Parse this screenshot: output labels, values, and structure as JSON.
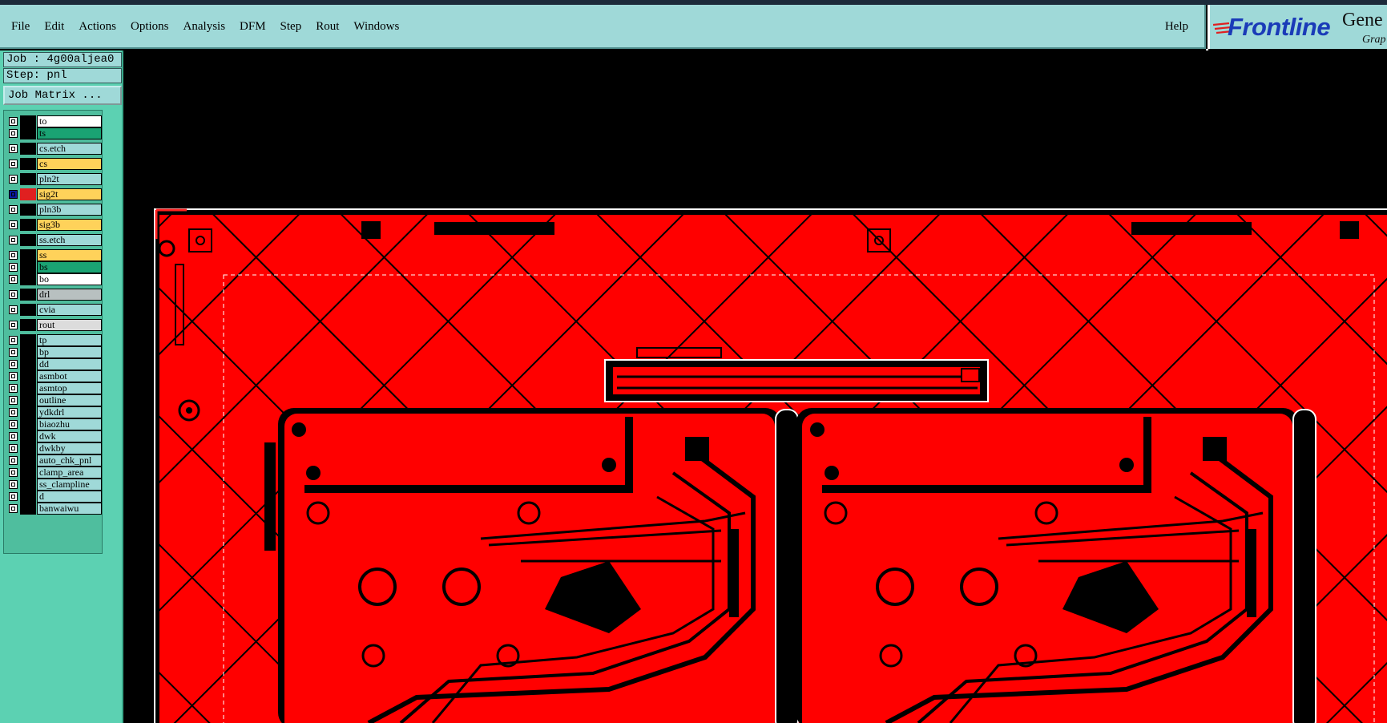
{
  "menubar": {
    "items": [
      {
        "label": "File"
      },
      {
        "label": "Edit"
      },
      {
        "label": "Actions"
      },
      {
        "label": "Options"
      },
      {
        "label": "Analysis"
      },
      {
        "label": "DFM"
      },
      {
        "label": "Step"
      },
      {
        "label": "Rout"
      },
      {
        "label": "Windows"
      }
    ],
    "help_label": "Help"
  },
  "logo": {
    "brand": "Frontline",
    "product": "Gene",
    "sub": "Grap"
  },
  "job": {
    "job_text": "Job : 4g00aljea0",
    "step_text": "Step: pnl",
    "matrix_label": "Job Matrix ..."
  },
  "layers": [
    {
      "name": "to",
      "color": "#ffffff"
    },
    {
      "name": "ts",
      "color": "#1aa373"
    },
    {
      "name": "cs.etch",
      "color": "#9fd9d8"
    },
    {
      "name": "cs",
      "color": "#ffd25a"
    },
    {
      "name": "pln2t",
      "color": "#9fd9d8"
    },
    {
      "name": "sig2t",
      "color": "#ffd25a",
      "active": true
    },
    {
      "name": "pln3b",
      "color": "#9fd9d8"
    },
    {
      "name": "sig3b",
      "color": "#ffd25a"
    },
    {
      "name": "ss.etch",
      "color": "#9fd9d8"
    },
    {
      "name": "ss",
      "color": "#ffd25a"
    },
    {
      "name": "bs",
      "color": "#1aa373"
    },
    {
      "name": "bo",
      "color": "#ffffff"
    },
    {
      "name": "drl",
      "color": "#b8c0c0"
    },
    {
      "name": "cvia",
      "color": "#9fd9d8"
    },
    {
      "name": "rout",
      "color": "#dcdcdc"
    },
    {
      "name": "tp",
      "color": "#9fd9d8"
    },
    {
      "name": "bp",
      "color": "#9fd9d8"
    },
    {
      "name": "dd",
      "color": "#9fd9d8"
    },
    {
      "name": "asmbot",
      "color": "#9fd9d8"
    },
    {
      "name": "asmtop",
      "color": "#9fd9d8"
    },
    {
      "name": "outline",
      "color": "#9fd9d8"
    },
    {
      "name": "ydkdrl",
      "color": "#9fd9d8"
    },
    {
      "name": "biaozhu",
      "color": "#9fd9d8"
    },
    {
      "name": "dwk",
      "color": "#9fd9d8"
    },
    {
      "name": "dwkby",
      "color": "#9fd9d8"
    },
    {
      "name": "auto_chk_pnl",
      "color": "#9fd9d8"
    },
    {
      "name": "clamp_area",
      "color": "#9fd9d8"
    },
    {
      "name": "ss_clampline",
      "color": "#9fd9d8"
    },
    {
      "name": "d",
      "color": "#9fd9d8"
    },
    {
      "name": "banwaiwu",
      "color": "#9fd9d8"
    }
  ],
  "colors": {
    "board_fill": "#ff0000",
    "canvas_bg": "#000000",
    "menubar_bg": "#9fd9d8",
    "panel_bg": "#5cd1b2"
  }
}
